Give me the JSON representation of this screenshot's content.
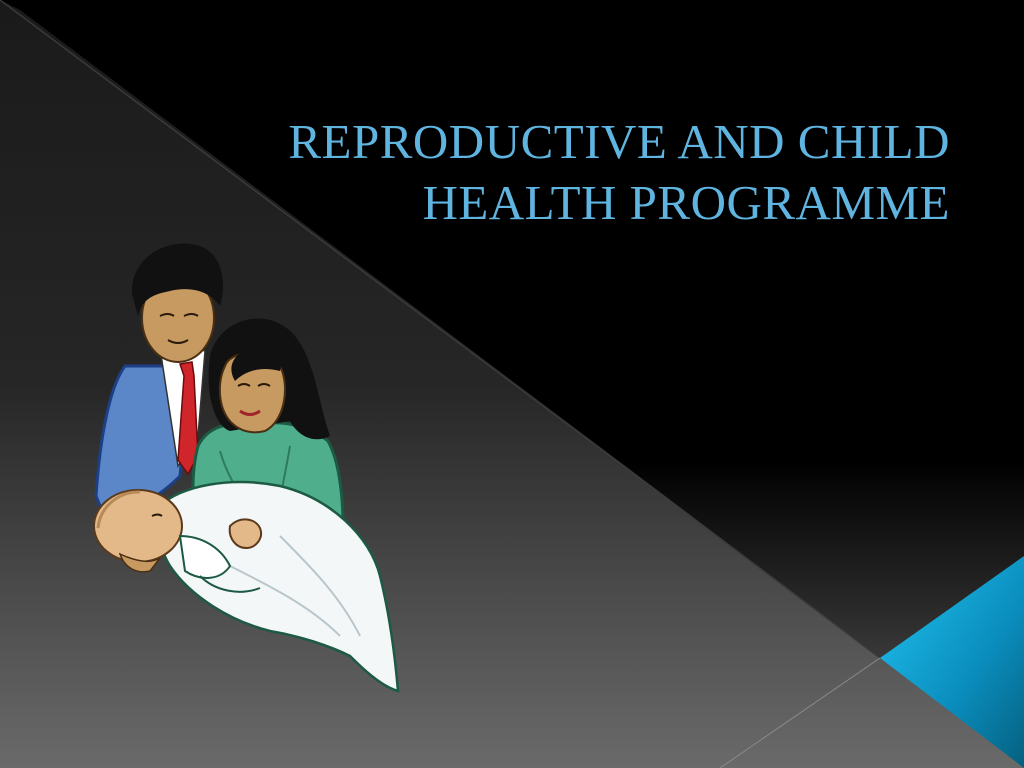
{
  "slide": {
    "title_line1": "REPRODUCTIVE AND CHILD",
    "title_line2": "HEALTH PROGRAMME"
  },
  "illustration": {
    "icon": "family-with-baby-icon"
  },
  "colors": {
    "background": "#000000",
    "title": "#5fb4e0",
    "accent": "#1aa7d6"
  }
}
